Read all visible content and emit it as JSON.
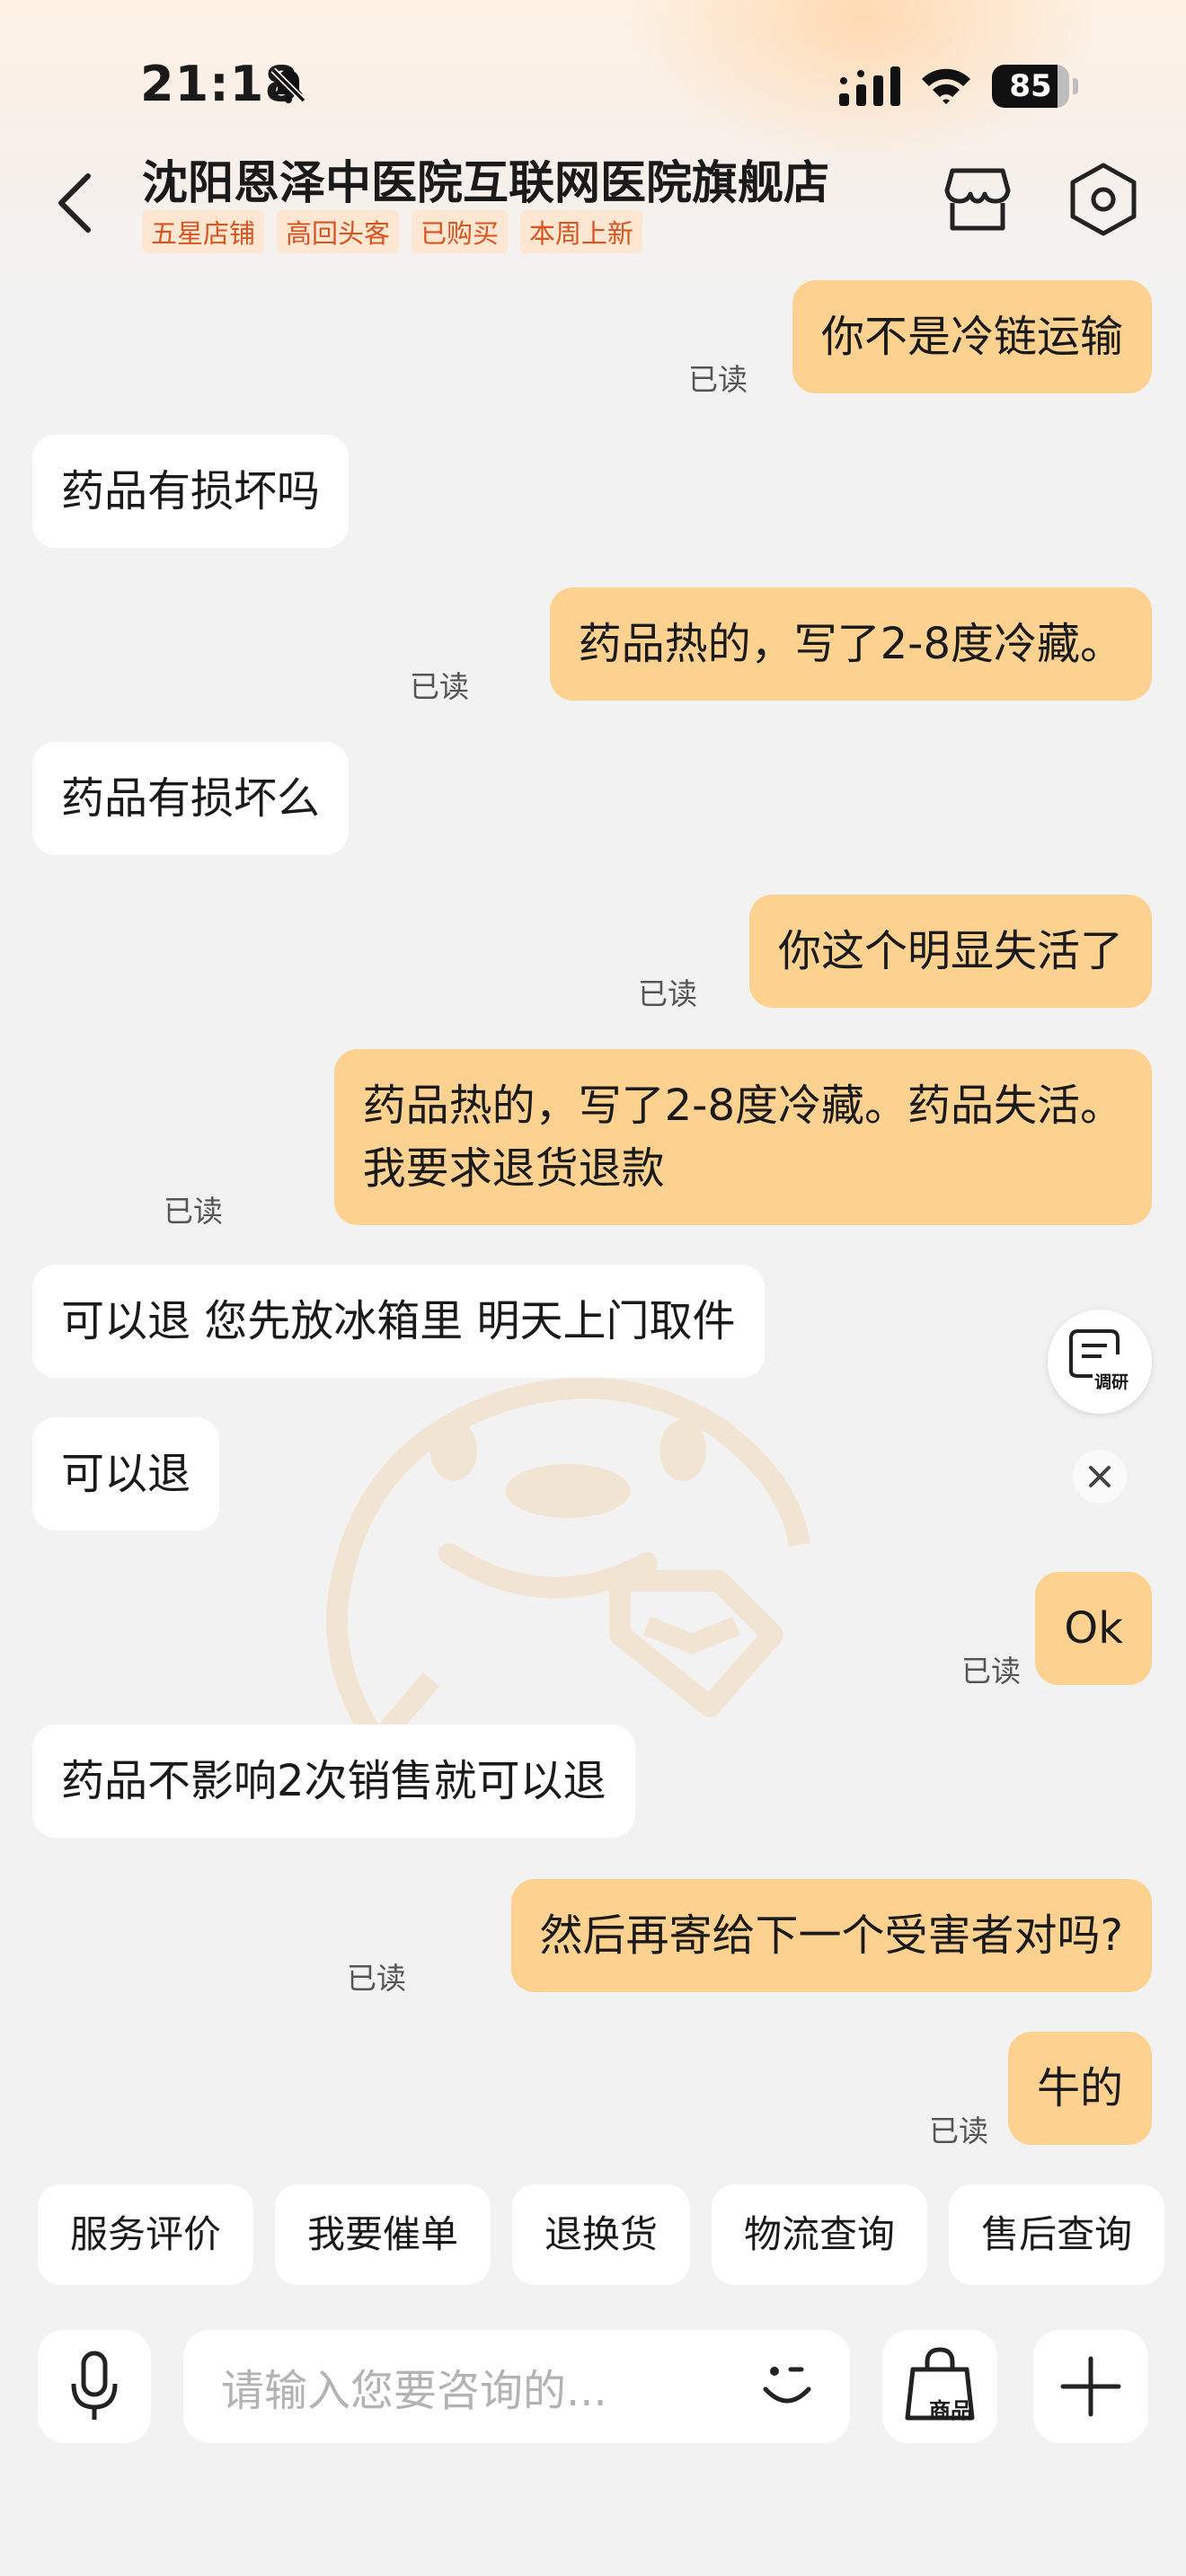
{
  "status_bar": {
    "time": "21:18",
    "battery": "85",
    "battery_level": 0.85
  },
  "header": {
    "title": "沈阳恩泽中医院互联网医院旗舰店",
    "tags": [
      "五星店铺",
      "高回头客",
      "已购买",
      "本周上新"
    ]
  },
  "read_label": "已读",
  "messages": [
    {
      "side": "out",
      "text": "你不是冷链运输"
    },
    {
      "side": "in",
      "text": "药品有损坏吗"
    },
    {
      "side": "out",
      "text": "药品热的，写了2-8度冷藏。"
    },
    {
      "side": "in",
      "text": "药品有损坏么"
    },
    {
      "side": "out",
      "text": "你这个明显失活了"
    },
    {
      "side": "out",
      "text": "药品热的，写了2-8度冷藏。药品失活。\n我要求退货退款"
    },
    {
      "side": "in",
      "text": "可以退 您先放冰箱里 明天上门取件"
    },
    {
      "side": "in",
      "text": "可以退"
    },
    {
      "side": "out",
      "text": "Ok"
    },
    {
      "side": "in",
      "text": "药品不影响2次销售就可以退"
    },
    {
      "side": "out",
      "text": "然后再寄给下一个受害者对吗?"
    },
    {
      "side": "out",
      "text": "牛的"
    }
  ],
  "survey": {
    "label": "调研"
  },
  "quick_replies": [
    "服务评价",
    "我要催单",
    "退换货",
    "物流查询",
    "售后查询"
  ],
  "input": {
    "placeholder": "请输入您要咨询的..."
  },
  "goods_label": "商品"
}
